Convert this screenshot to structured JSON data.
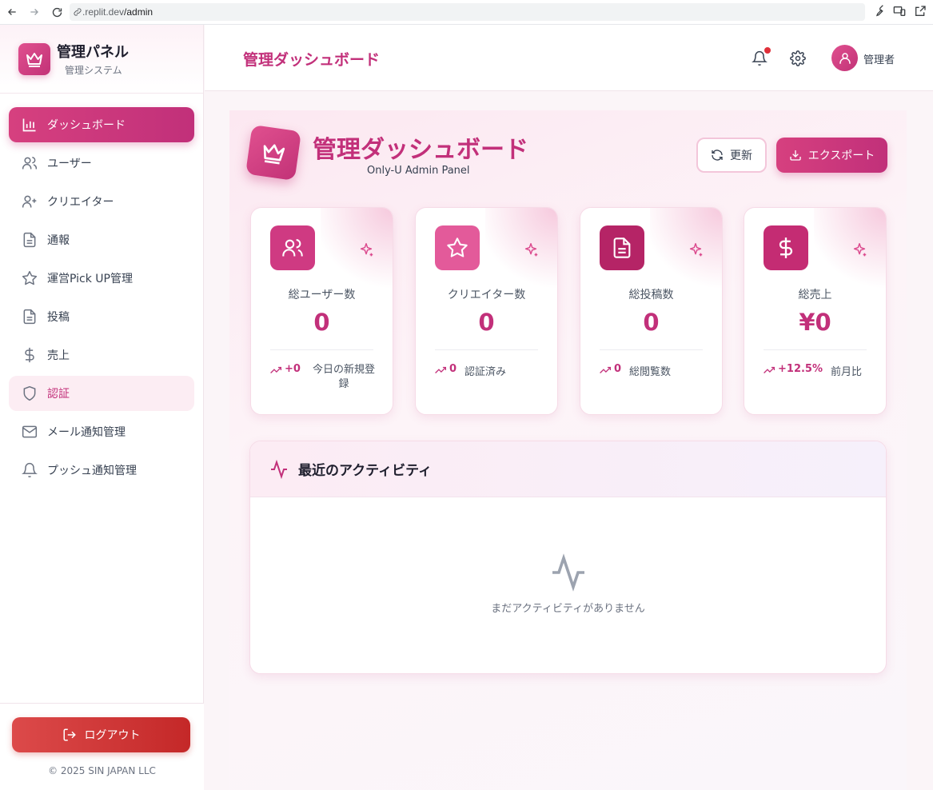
{
  "browser": {
    "url_prefix": ".replit.dev",
    "url_path": "/admin"
  },
  "sidebar": {
    "brand_title": "管理パネル",
    "brand_subtitle": "管理システム",
    "items": [
      {
        "label": "ダッシュボード",
        "icon": "bar-chart-icon",
        "state": "active"
      },
      {
        "label": "ユーザー",
        "icon": "users-icon",
        "state": "normal"
      },
      {
        "label": "クリエイター",
        "icon": "user-plus-icon",
        "state": "normal"
      },
      {
        "label": "通報",
        "icon": "file-icon",
        "state": "normal"
      },
      {
        "label": "運営Pick UP管理",
        "icon": "star-icon",
        "state": "normal"
      },
      {
        "label": "投稿",
        "icon": "file-icon",
        "state": "normal"
      },
      {
        "label": "売上",
        "icon": "dollar-icon",
        "state": "normal"
      },
      {
        "label": "認証",
        "icon": "shield-icon",
        "state": "highlight"
      },
      {
        "label": "メール通知管理",
        "icon": "mail-icon",
        "state": "normal"
      },
      {
        "label": "プッシュ通知管理",
        "icon": "bell-icon",
        "state": "normal"
      }
    ],
    "logout_label": "ログアウト",
    "copyright": "© 2025 SIN JAPAN LLC"
  },
  "header": {
    "title": "管理ダッシュボード",
    "user_label": "管理者"
  },
  "main": {
    "title": "管理ダッシュボード",
    "subtitle": "Only-U Admin Panel",
    "refresh_label": "更新",
    "export_label": "エクスポート",
    "stats": [
      {
        "label": "総ユーザー数",
        "value": "0",
        "delta": "+0",
        "desc": "今日の新規登録",
        "icon": "users-icon",
        "icon_bg": "#cf3a82"
      },
      {
        "label": "クリエイター数",
        "value": "0",
        "delta": "0",
        "desc": "認証済み",
        "icon": "star-icon",
        "icon_bg": "#e35a9a"
      },
      {
        "label": "総投稿数",
        "value": "0",
        "delta": "0",
        "desc": "総閲覧数",
        "icon": "file-icon",
        "icon_bg": "#b52466"
      },
      {
        "label": "総売上",
        "value": "¥0",
        "delta": "+12.5%",
        "desc": "前月比",
        "icon": "dollar-icon",
        "icon_bg": "#c42c73"
      }
    ],
    "activity": {
      "title": "最近のアクティビティ",
      "empty_text": "まだアクティビティがありません"
    }
  },
  "colors": {
    "accent": "#c2307a",
    "logout": "#d13a3a"
  }
}
